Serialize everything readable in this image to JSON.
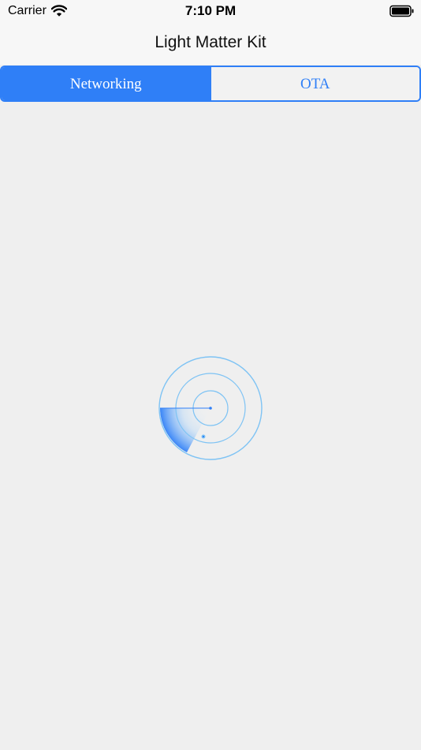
{
  "status_bar": {
    "carrier": "Carrier",
    "time": "7:10 PM",
    "wifi_icon": "wifi-icon",
    "battery_icon": "battery-icon"
  },
  "nav": {
    "title": "Light Matter Kit"
  },
  "tabs": [
    {
      "label": "Networking",
      "selected": true
    },
    {
      "label": "OTA",
      "selected": false
    }
  ],
  "radar": {
    "icon": "radar-scan-icon",
    "accent_color": "#2f7ff7",
    "ring_color": "#7ec3f4"
  },
  "colors": {
    "accent": "#2f7ff7",
    "background": "#efefef",
    "header": "#f7f7f7"
  }
}
